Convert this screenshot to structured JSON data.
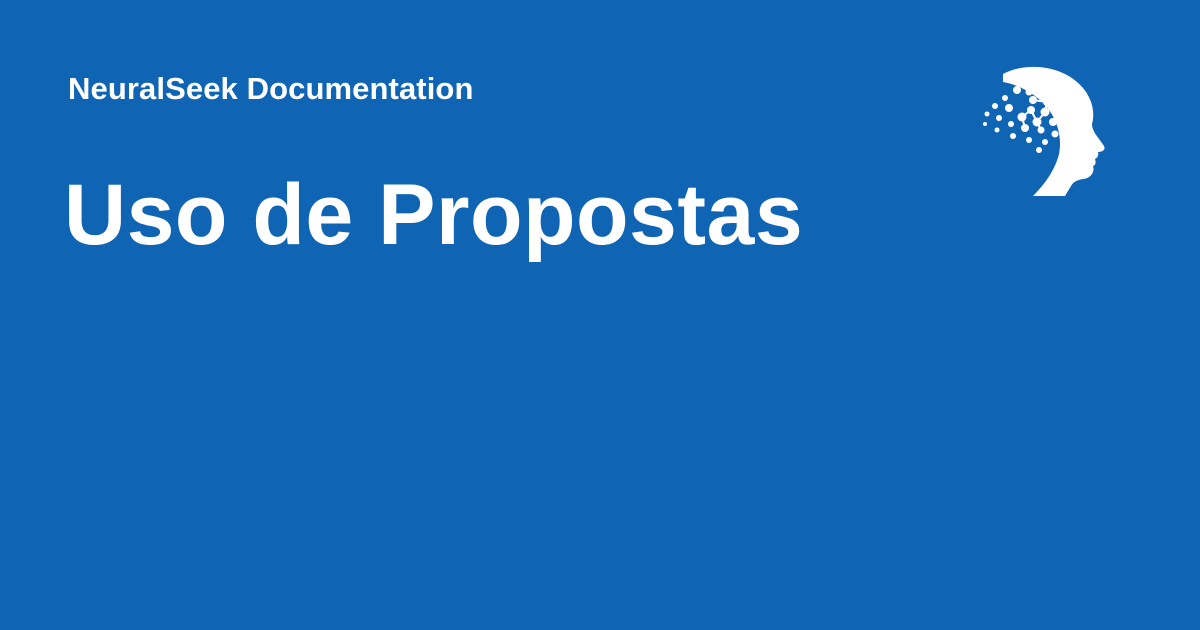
{
  "header": {
    "site_name": "NeuralSeek Documentation",
    "logo_icon": "brain-head-logo-icon"
  },
  "main": {
    "title": "Uso de Propostas"
  },
  "colors": {
    "background": "#0f65b4",
    "text": "#ffffff"
  }
}
